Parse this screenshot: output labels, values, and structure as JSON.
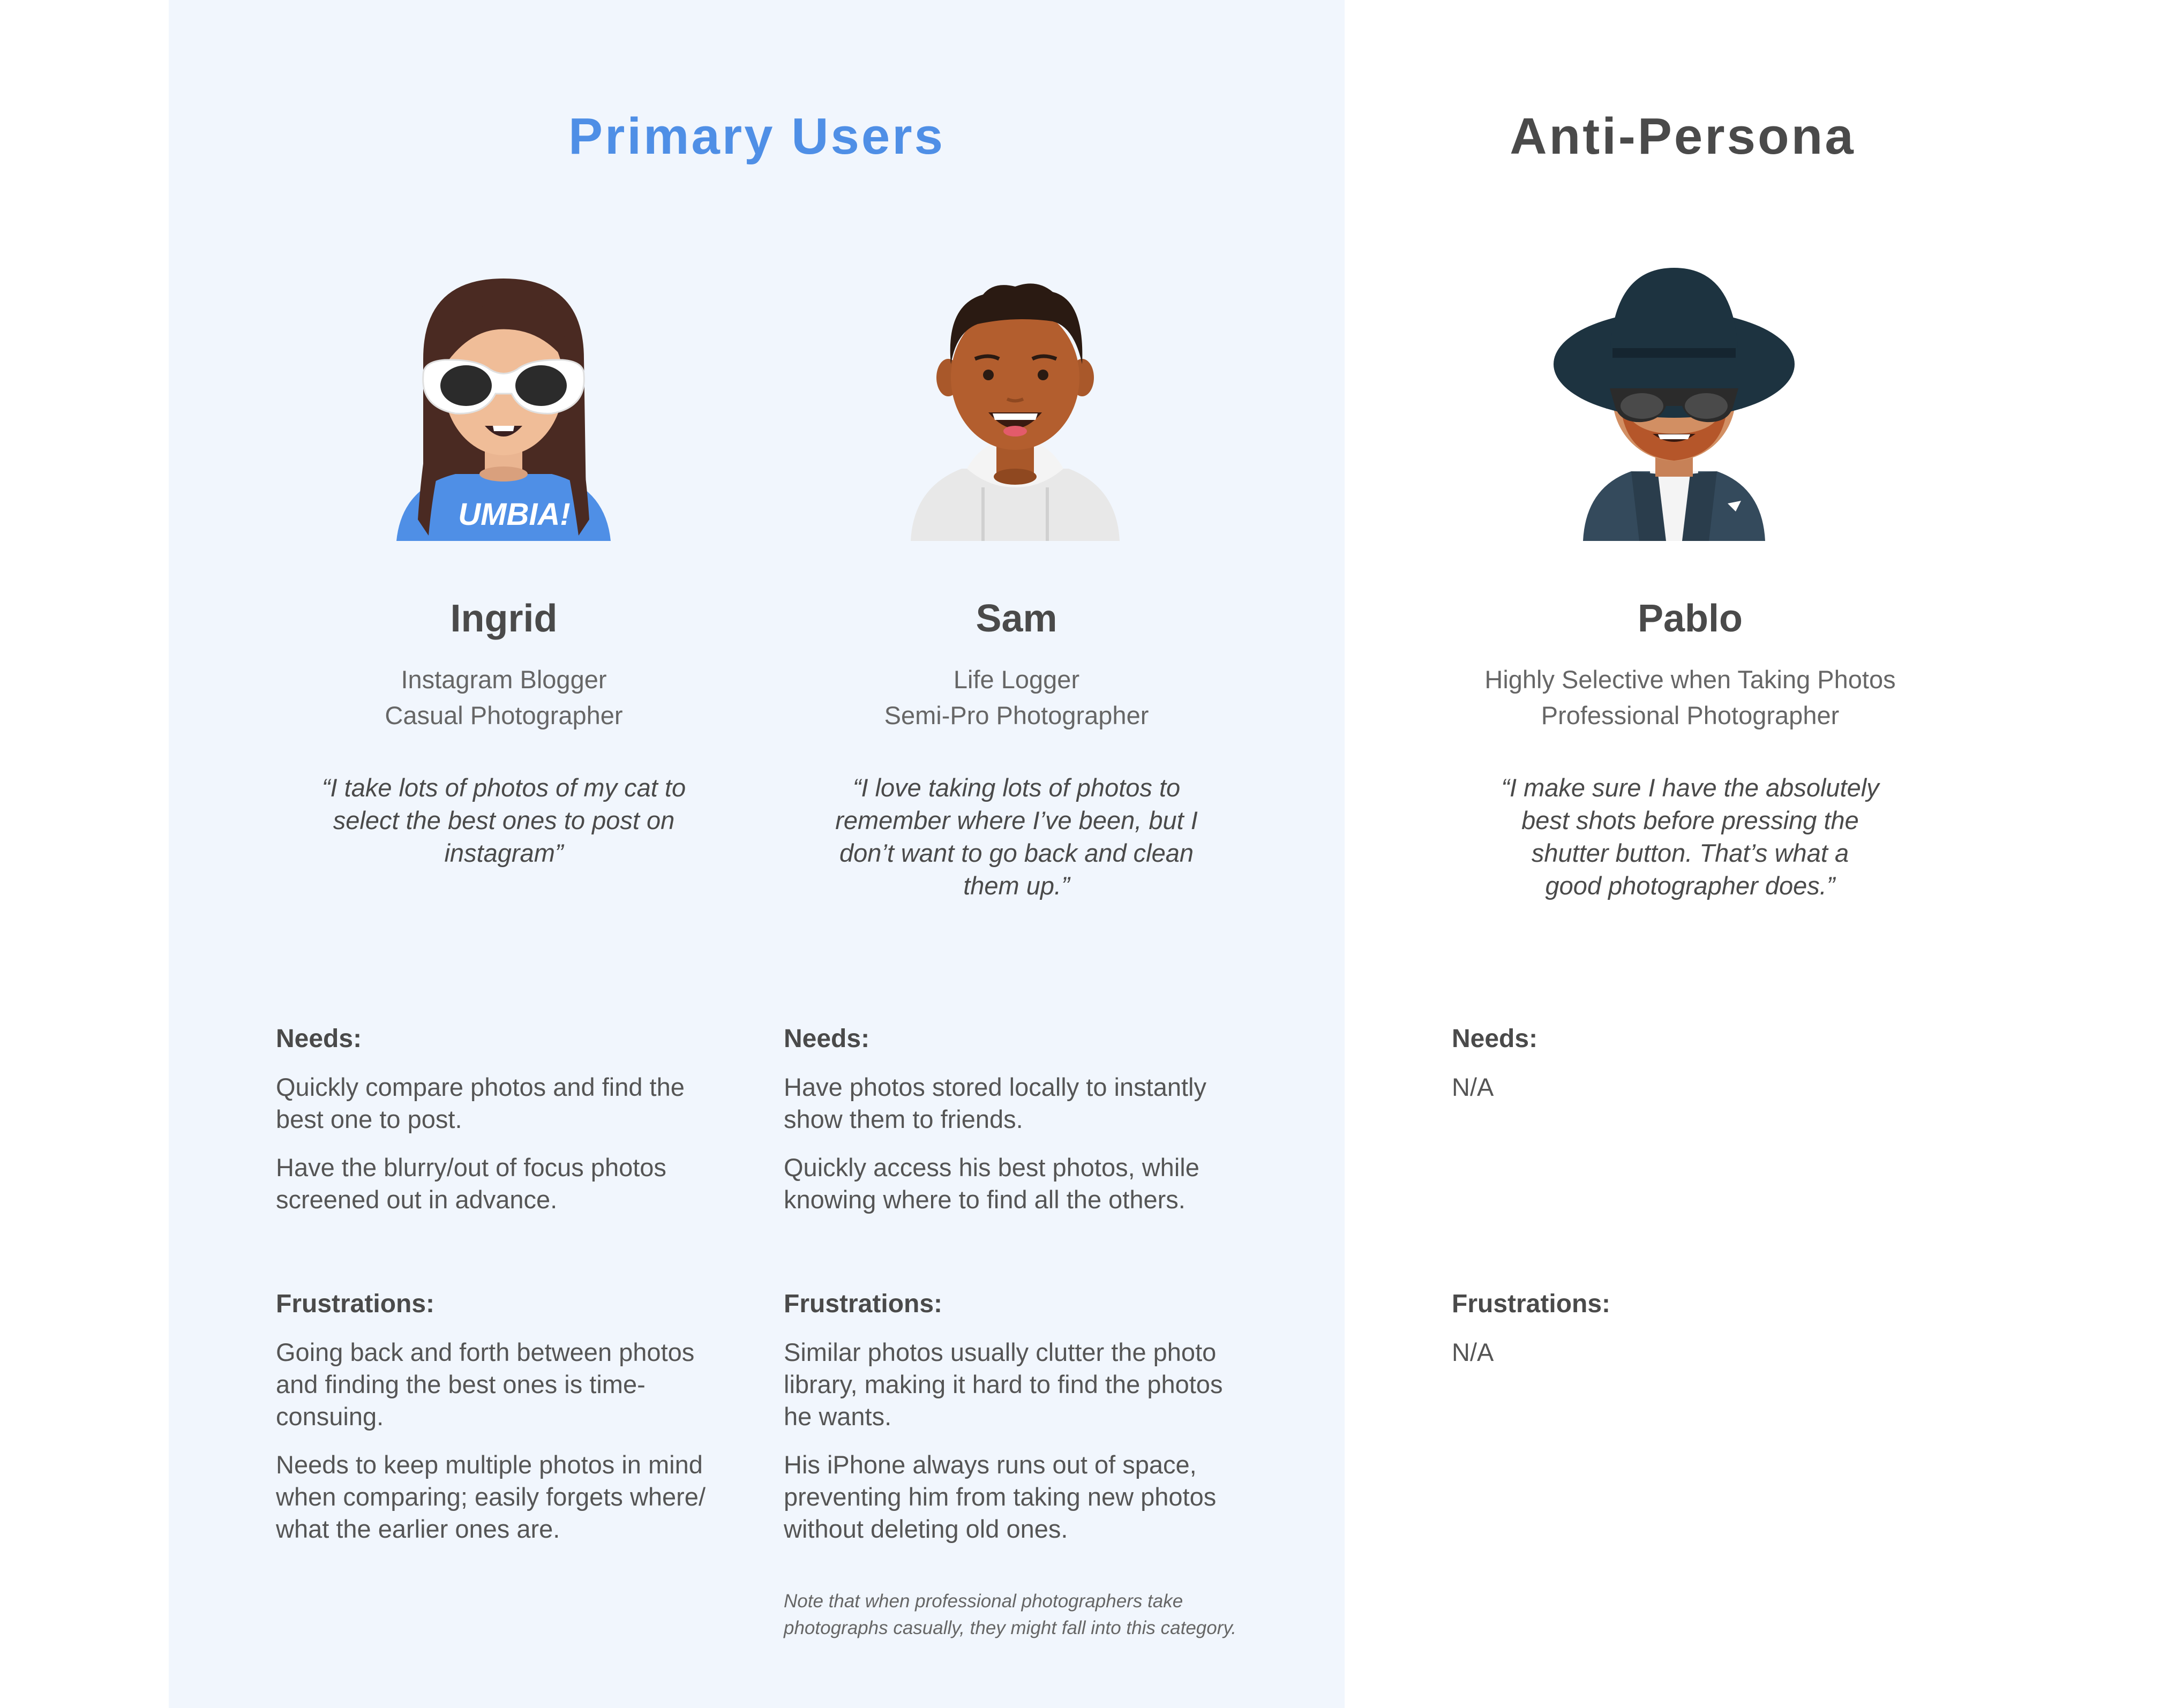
{
  "headings": {
    "primary": "Primary Users",
    "anti": "Anti-Persona"
  },
  "personas": [
    {
      "name": "Ingrid",
      "roles": [
        "Instagram Blogger",
        "Casual Photographer"
      ],
      "quote_lines": [
        "“I take lots of photos of my cat to",
        "select the best ones to post on",
        "instagram”"
      ],
      "shirt_text": "UMBIA!",
      "needs_label": "Needs:",
      "needs": [
        [
          "Quickly compare photos and find the",
          "best one to post."
        ],
        [
          "Have the blurry/out of focus photos",
          "screened out in advance."
        ]
      ],
      "frustrations_label": "Frustrations:",
      "frustrations": [
        [
          "Going back and forth between photos",
          "and finding the best ones is time-",
          "consuing."
        ],
        [
          "Needs to keep multiple photos in mind",
          "when comparing; easily forgets where/",
          "what the earlier ones are."
        ]
      ]
    },
    {
      "name": "Sam",
      "roles": [
        "Life Logger",
        "Semi-Pro Photographer"
      ],
      "quote_lines": [
        "“I love taking lots of photos to",
        "remember where I’ve been, but I",
        "don’t want to go back and clean",
        "them up.”"
      ],
      "needs_label": "Needs:",
      "needs": [
        [
          "Have photos stored locally to instantly",
          "show them to friends."
        ],
        [
          "Quickly access his best photos, while",
          "knowing where to find all the others."
        ]
      ],
      "frustrations_label": "Frustrations:",
      "frustrations": [
        [
          "Similar photos usually clutter the photo",
          "library, making it hard to find the photos",
          "he wants."
        ],
        [
          "His iPhone always runs out of space,",
          "preventing him from taking new photos",
          "without deleting old ones."
        ]
      ],
      "note_lines": [
        "Note that when professional photographers take",
        "photographs casually, they might fall into this category."
      ]
    },
    {
      "name": "Pablo",
      "roles": [
        "Highly Selective when Taking Photos",
        "Professional Photographer"
      ],
      "quote_lines": [
        "“I make sure I have the absolutely",
        "best shots before pressing the",
        "shutter button. That’s what a",
        "good photographer does.”"
      ],
      "needs_label": "Needs:",
      "needs_value": "N/A",
      "frustrations_label": "Frustrations:",
      "frustrations_value": "N/A"
    }
  ],
  "colors": {
    "accent_blue": "#4f8fe6",
    "panel_bg": "#f1f6fd",
    "heading_gray": "#4a4a4a"
  }
}
